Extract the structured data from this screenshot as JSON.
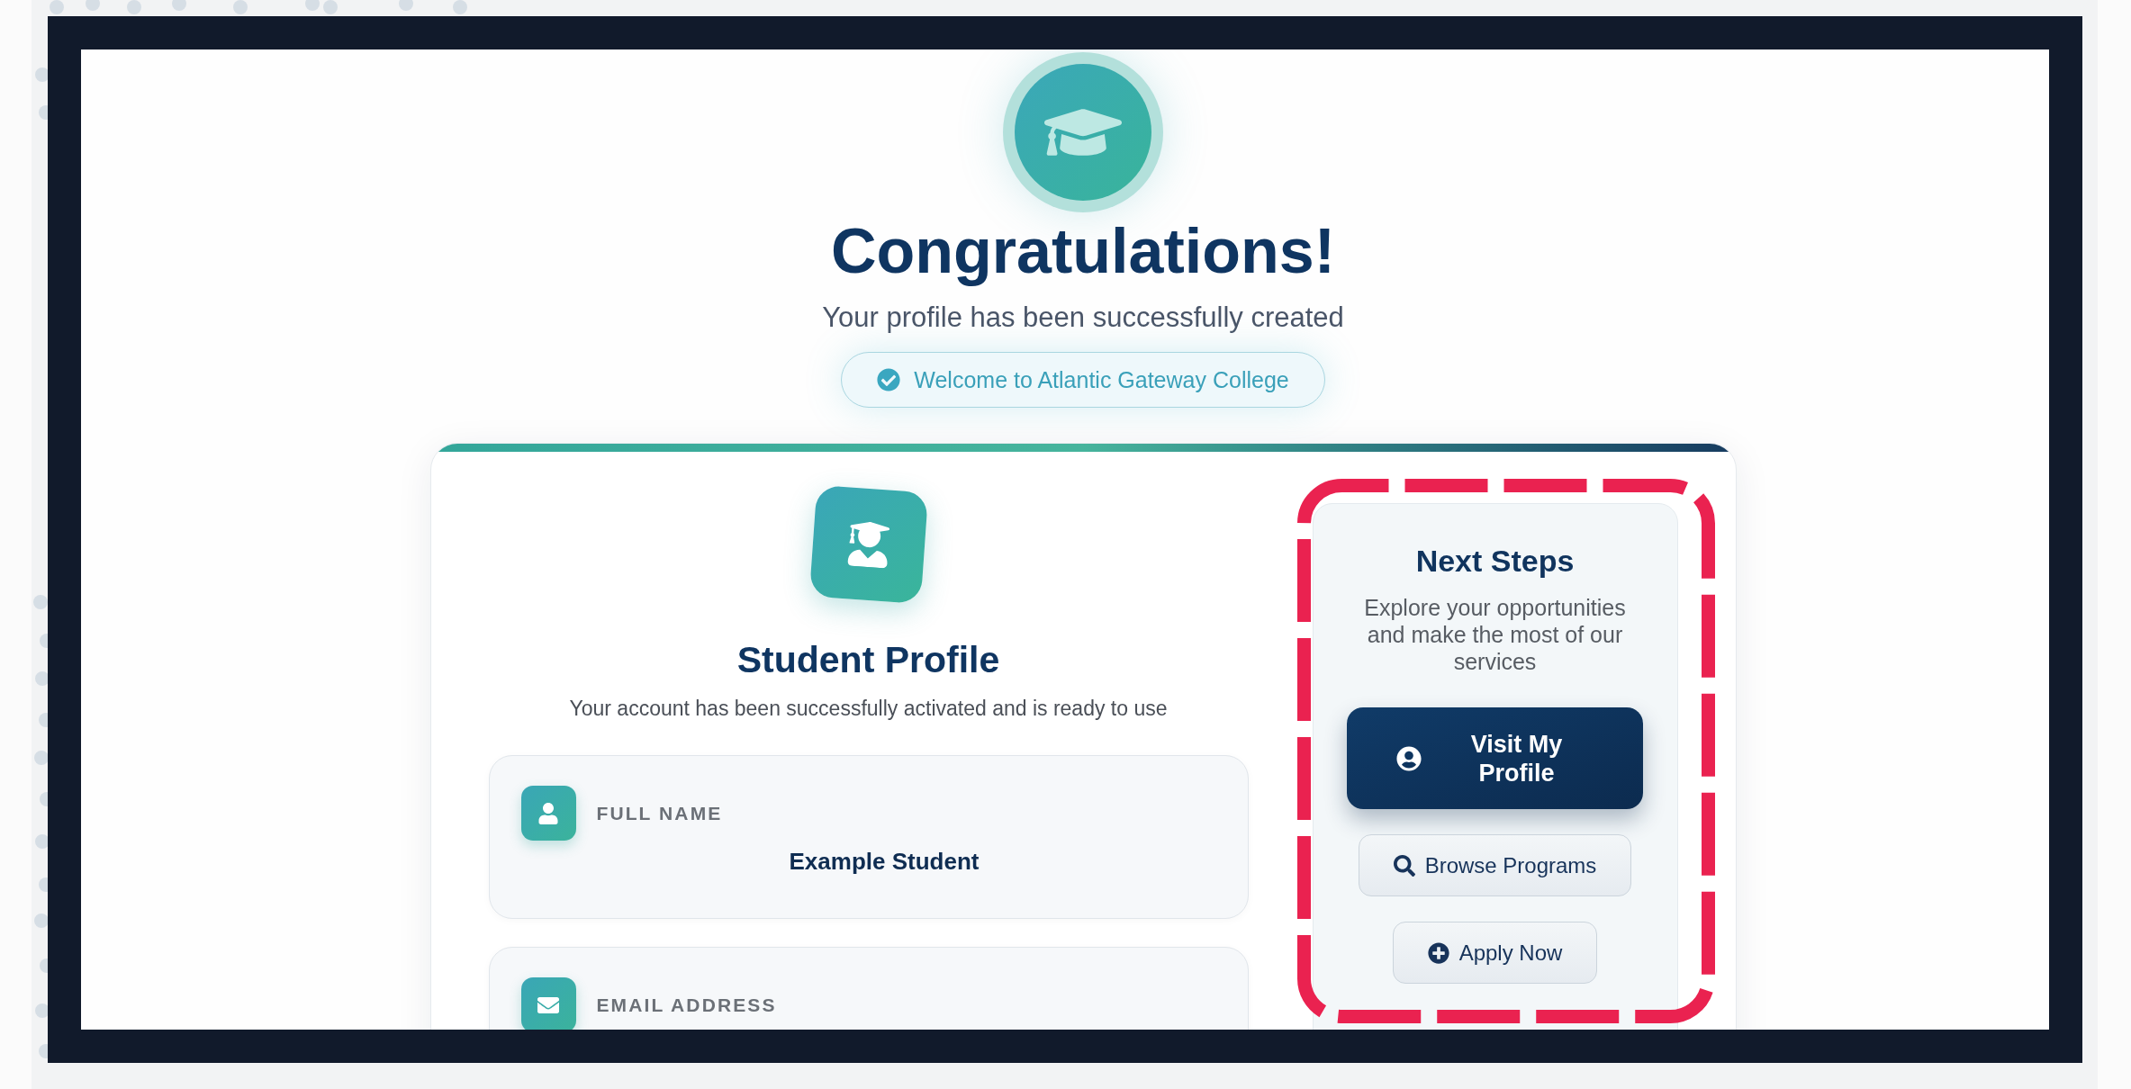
{
  "hero": {
    "title": "Congratulations!",
    "subtitle": "Your profile has been successfully created",
    "badge": "Welcome to Atlantic Gateway College"
  },
  "profile": {
    "title": "Student Profile",
    "subtitle": "Your account has been successfully activated and is ready to use",
    "fields": [
      {
        "kind": "name",
        "label": "FULL NAME",
        "value": "Example Student"
      },
      {
        "kind": "email",
        "label": "EMAIL ADDRESS"
      }
    ]
  },
  "next_steps": {
    "highlighted": true,
    "title": "Next Steps",
    "description": "Explore your opportunities and make the most of our services",
    "actions": [
      {
        "kind": "primary",
        "label": "Visit My Profile"
      },
      {
        "kind": "secondary",
        "label": "Browse Programs"
      },
      {
        "kind": "secondary",
        "label": "Apply Now"
      }
    ]
  }
}
